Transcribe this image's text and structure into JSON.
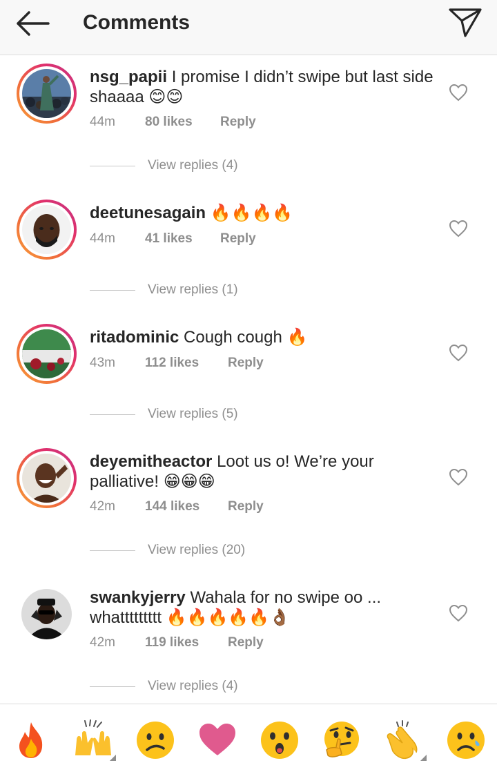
{
  "header": {
    "title": "Comments",
    "back_icon": "arrow-left-icon",
    "send_icon": "paper-plane-icon"
  },
  "comments": [
    {
      "username": "nsg_papii",
      "text": "I promise I didn’t swipe but last side shaaaa 😊😊",
      "time": "44m",
      "likes": "80 likes",
      "reply": "Reply",
      "view_replies": "View replies (4)"
    },
    {
      "username": "deetunesagain",
      "text": "🔥🔥🔥🔥",
      "time": "44m",
      "likes": "41 likes",
      "reply": "Reply",
      "view_replies": "View replies (1)"
    },
    {
      "username": "ritadominic",
      "text": "Cough cough 🔥",
      "time": "43m",
      "likes": "112 likes",
      "reply": "Reply",
      "view_replies": "View replies (5)"
    },
    {
      "username": "deyemitheactor",
      "text": "Loot us o! We’re your palliative! 😁😁😁",
      "time": "42m",
      "likes": "144 likes",
      "reply": "Reply",
      "view_replies": "View replies (20)"
    },
    {
      "username": "swankyjerry",
      "text": "Wahala for no swipe oo ... whattttttttt 🔥🔥🔥🔥🔥👌🏾",
      "time": "42m",
      "likes": "119 likes",
      "reply": "Reply",
      "view_replies": "View replies (4)"
    }
  ],
  "emoji_bar": [
    {
      "name": "fire-emoji"
    },
    {
      "name": "raising-hands-emoji"
    },
    {
      "name": "confused-face-emoji"
    },
    {
      "name": "heart-emoji"
    },
    {
      "name": "surprised-face-emoji"
    },
    {
      "name": "thinking-face-emoji"
    },
    {
      "name": "clapping-hands-emoji"
    },
    {
      "name": "sad-face-emoji"
    }
  ],
  "colors": {
    "accent_ring": "#e1306c",
    "muted_text": "#8e8e8e",
    "text": "#262626",
    "heart": "#e05a8e"
  }
}
